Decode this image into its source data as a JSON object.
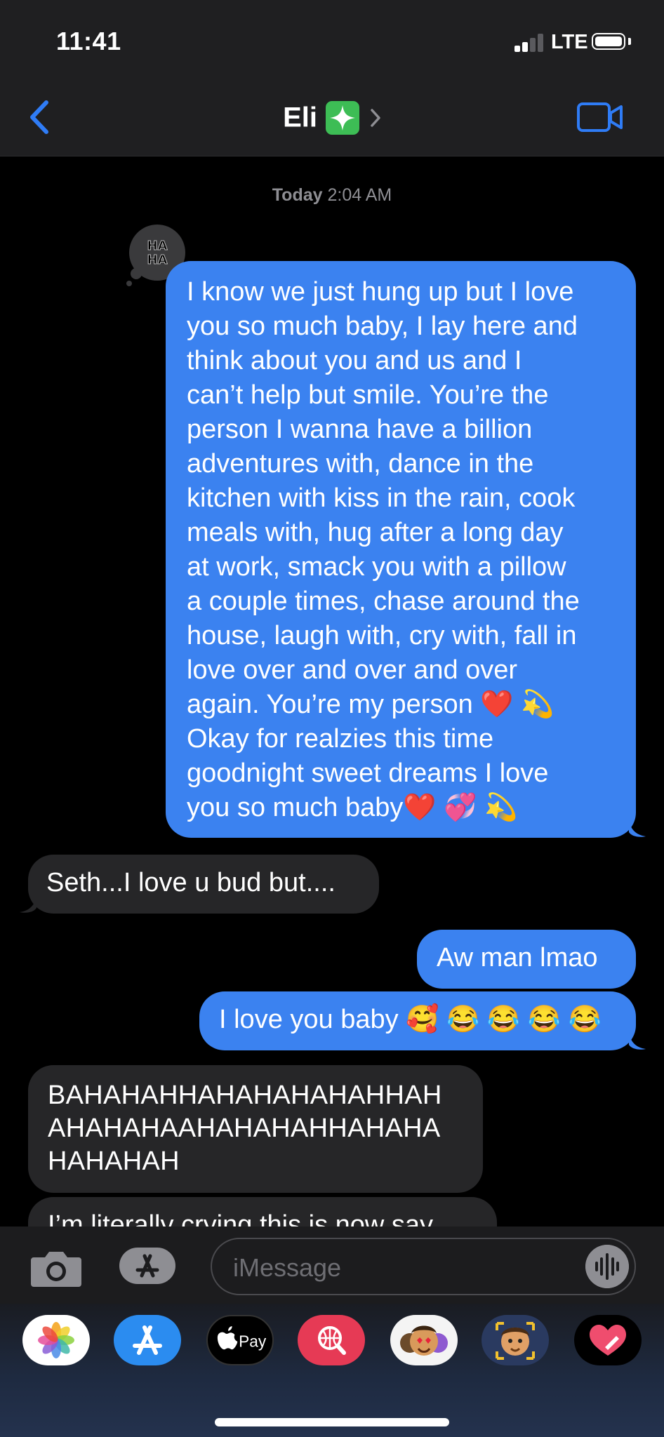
{
  "status_bar": {
    "time": "11:41",
    "network": "LTE"
  },
  "nav": {
    "contact_name": "Eli",
    "badge_icon": "sparkles-icon"
  },
  "conversation": {
    "timestamp_day": "Today",
    "timestamp_time": "2:04 AM",
    "tapback": "HA HA",
    "messages": [
      {
        "direction": "sent",
        "lines": [
          "I know we just hung up but I love",
          "you so much baby, I lay here and",
          "think about you and us and I",
          "can’t help but smile. You’re the",
          "person I wanna have a billion",
          "adventures with, dance in the",
          "kitchen with kiss in the rain, cook",
          "meals with, hug after a long day",
          "at work, smack you with a pillow",
          "a couple times, chase around the",
          "house, laugh with, cry with, fall in",
          "love over and over and over",
          "again. You’re my person ❤️ 💫",
          "Okay for realzies this time",
          "goodnight sweet dreams I love",
          "you so much baby❤️ 💞 💫"
        ]
      },
      {
        "direction": "received",
        "text": "Seth...I love u bud but...."
      },
      {
        "direction": "sent",
        "text": "Aw man lmao"
      },
      {
        "direction": "sent",
        "text": "I love you baby 🥰 😂 😂 😂 😂"
      },
      {
        "direction": "received",
        "lines": [
          "BAHAHAHHAHAHAHAHAHHAH",
          "AHAHAHAAHAHAHAHHAHAHA",
          "HAHAHAH"
        ]
      },
      {
        "direction": "received",
        "text": "I’m literally crying this is now say"
      }
    ]
  },
  "composer": {
    "placeholder": "iMessage"
  },
  "app_drawer": {
    "apps": [
      {
        "name": "photos-app-icon"
      },
      {
        "name": "app-store-app-icon"
      },
      {
        "name": "apple-pay-app-icon",
        "label": "Pay"
      },
      {
        "name": "web-images-app-icon"
      },
      {
        "name": "memoji-stickers-app-icon"
      },
      {
        "name": "animoji-app-icon"
      },
      {
        "name": "digital-touch-app-icon"
      }
    ]
  },
  "colors": {
    "sent_bubble": "#3b82f0",
    "received_bubble": "#262628",
    "accent": "#2f7cf6"
  }
}
